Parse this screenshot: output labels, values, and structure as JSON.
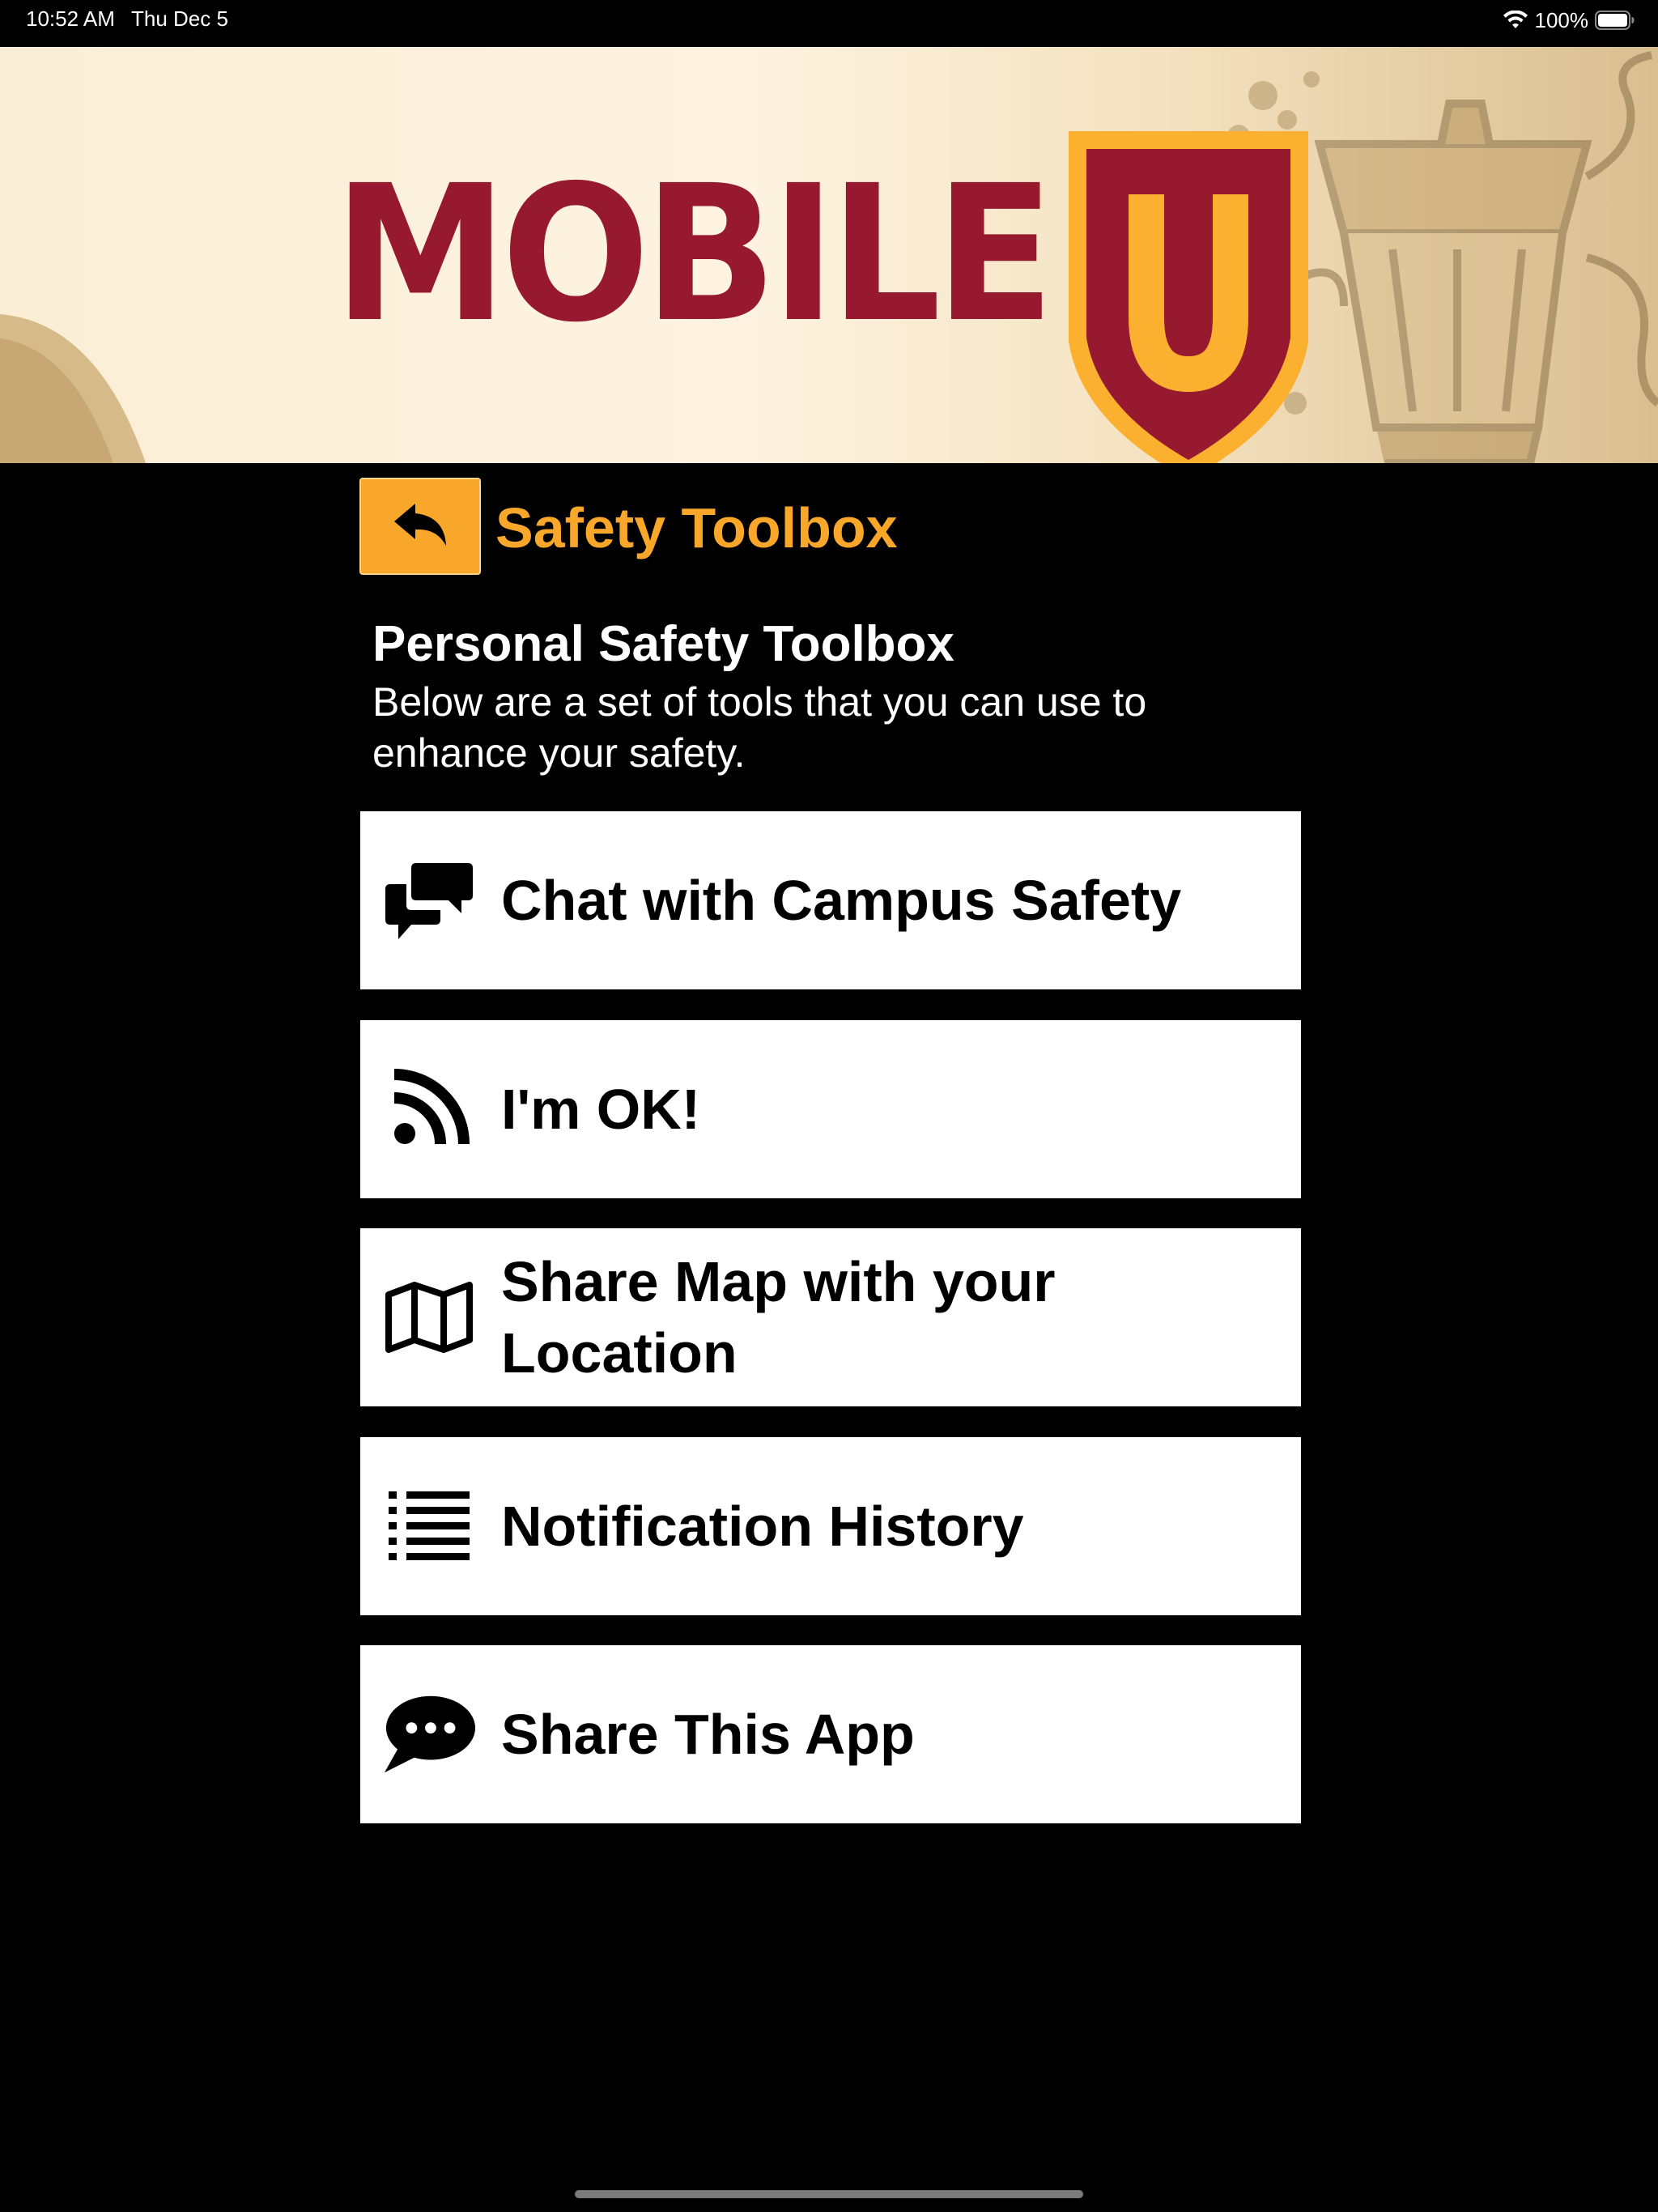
{
  "status_bar": {
    "time": "10:52 AM",
    "date": "Thu Dec 5",
    "battery_percent": "100%",
    "icons": [
      "wifi-icon",
      "battery-icon"
    ]
  },
  "banner": {
    "wordmark": "MOBILE",
    "shield_letter": "U",
    "colors": {
      "brand_red": "#97192f",
      "brand_gold": "#fbb02f"
    }
  },
  "header": {
    "back_icon": "back-arrow-icon",
    "title": "Safety Toolbox",
    "accent_color": "#f9a72b"
  },
  "intro": {
    "heading": "Personal Safety Toolbox",
    "text": "Below are a set of tools that you can use to enhance your safety."
  },
  "tools": [
    {
      "icon": "chat-bubbles-icon",
      "label": "Chat with Campus Safety"
    },
    {
      "icon": "rss-signal-icon",
      "label": "I'm OK!"
    },
    {
      "icon": "map-icon",
      "label": "Share Map with your Location"
    },
    {
      "icon": "list-icon",
      "label": "Notification History"
    },
    {
      "icon": "speech-bubble-dots-icon",
      "label": "Share This App"
    }
  ]
}
